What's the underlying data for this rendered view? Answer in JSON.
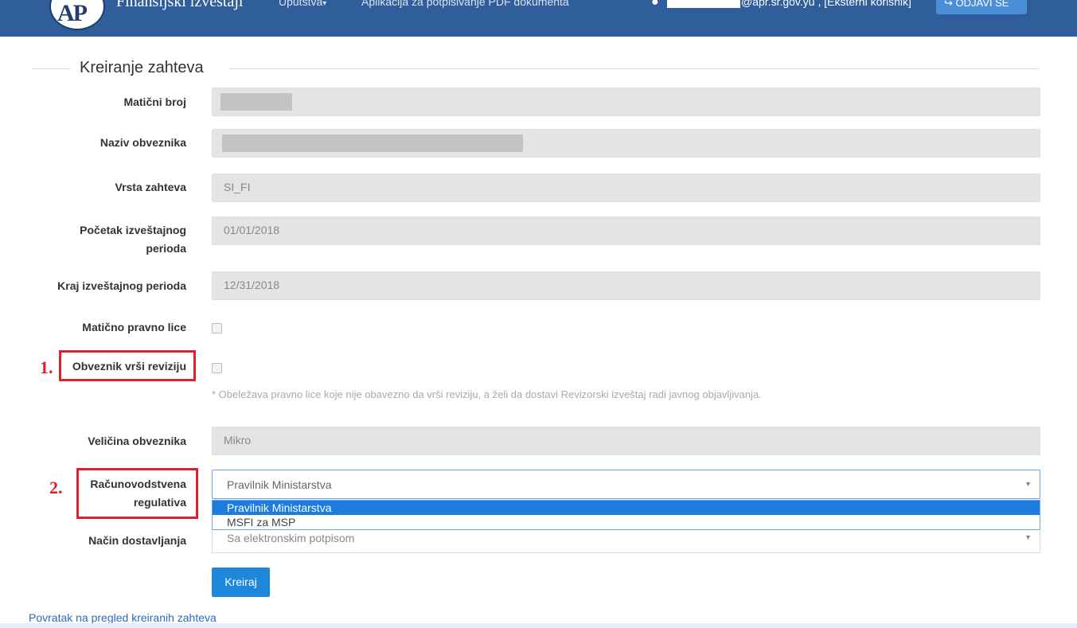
{
  "header": {
    "logo_text": "AP",
    "brand": "Finansijski izveštaji",
    "nav": [
      {
        "label": "Uputstva",
        "caret": "▾"
      },
      {
        "label": "Aplikacija za potpisivanje PDF dokumenta"
      }
    ],
    "user_text": "@apr.sr.gov.yu , [Eksterni korisnik]",
    "logout_label": "↪ ODJAVI SE"
  },
  "form": {
    "title": "Kreiranje zahteva",
    "fields": {
      "maticni_broj": {
        "label": "Matični broj",
        "value": ""
      },
      "naziv": {
        "label": "Naziv obveznika",
        "value": ""
      },
      "vrsta": {
        "label": "Vrsta zahteva",
        "value": "SI_FI"
      },
      "pocetak": {
        "label_line1": "Početak izveštajnog",
        "label_line2": "perioda",
        "value": "01/01/2018"
      },
      "kraj": {
        "label": "Kraj izveštajnog perioda",
        "value": "12/31/2018"
      },
      "maticno_lice": {
        "label": "Matično pravno lice",
        "checked": false
      },
      "revizija": {
        "label": "Obveznik vrši reviziju",
        "checked": false
      },
      "note": "* Obeležava pravno lice koje nije obavezno da vrši reviziju, a želi da dostavi Revizorski izveštaj radi javnog objavljivanja.",
      "velicina": {
        "label": "Veličina obveznika",
        "value": "Mikro"
      },
      "regulativa": {
        "label_line1": "Računovodstvena",
        "label_line2": "regulativa",
        "value": "Pravilnik Ministarstva",
        "options": [
          "Pravilnik Ministarstva",
          "MSFI za MSP"
        ]
      },
      "nacin": {
        "label": "Način dostavljanja",
        "value": "Sa elektronskim potpisom"
      }
    },
    "create_button": "Kreiraj",
    "back_link": "Povratak na pregled kreiranih zahteva"
  },
  "annotations": {
    "one": "1.",
    "two": "2."
  },
  "colors": {
    "header_bg": "#2f5e9b",
    "primary_button": "#1e87d9",
    "selected_option": "#1e7be0",
    "annotation_red": "#e0202a"
  },
  "icons": {
    "user": "user-icon",
    "logout": "logout-icon",
    "dropdown_arrow": "chevron-down-icon"
  }
}
